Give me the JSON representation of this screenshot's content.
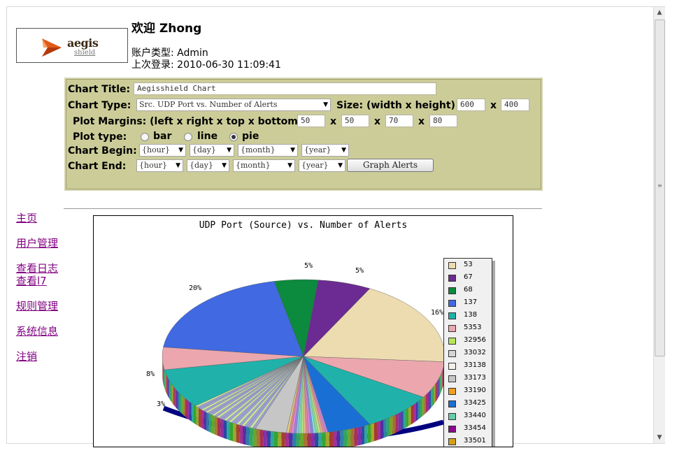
{
  "header": {
    "logo_text": "aegis",
    "logo_sub": "shield",
    "welcome": "欢迎 Zhong",
    "account_type": "账户类型: Admin",
    "last_login": "上次登录: 2010-06-30 11:09:41"
  },
  "form": {
    "chart_title_label": "Chart Title:",
    "chart_title_value": "Aegisshield Chart",
    "chart_type_label": "Chart Type:",
    "chart_type_value": "Src. UDP Port vs. Number of Alerts",
    "size_label": "Size: (width x height)",
    "width": "600",
    "height": "400",
    "x_sep": "x",
    "margins_label": "Plot Margins: (left x right x top x bottom)",
    "margin_left": "50",
    "margin_right": "50",
    "margin_top": "70",
    "margin_bottom": "80",
    "plot_type_label": "Plot type:",
    "plot_types": [
      "bar",
      "line",
      "pie"
    ],
    "plot_type_selected": "pie",
    "begin_label": "Chart Begin:",
    "end_label": "Chart End:",
    "hour": "{hour}",
    "day": "{day}",
    "month": "{month}",
    "year": "{year}",
    "graph_button": "Graph Alerts"
  },
  "nav": {
    "items": [
      "主页",
      "用户管理",
      "查看日志",
      "查看l7",
      "规则管理",
      "系统信息",
      "注销"
    ]
  },
  "chart_data": {
    "type": "pie",
    "title": "UDP Port (Source) vs. Number of Alerts",
    "slice_labels": [
      "5%",
      "5%",
      "16%",
      "20%",
      "8%",
      "3%"
    ],
    "legend": [
      {
        "name": "53",
        "color": "#ecdcb0"
      },
      {
        "name": "67",
        "color": "#6b2b92"
      },
      {
        "name": "68",
        "color": "#0c8a3e"
      },
      {
        "name": "137",
        "color": "#4169e1"
      },
      {
        "name": "138",
        "color": "#20b2aa"
      },
      {
        "name": "5353",
        "color": "#eba7ad"
      },
      {
        "name": "32956",
        "color": "#b3e65a"
      },
      {
        "name": "33032",
        "color": "#d6d3d3"
      },
      {
        "name": "33138",
        "color": "#f5f1e6"
      },
      {
        "name": "33173",
        "color": "#c6c6c6"
      },
      {
        "name": "33190",
        "color": "#f0a020"
      },
      {
        "name": "33425",
        "color": "#1a6fd4"
      },
      {
        "name": "33440",
        "color": "#66ccaa"
      },
      {
        "name": "33454",
        "color": "#8b0a8b"
      },
      {
        "name": "33501",
        "color": "#d4a017"
      }
    ]
  }
}
